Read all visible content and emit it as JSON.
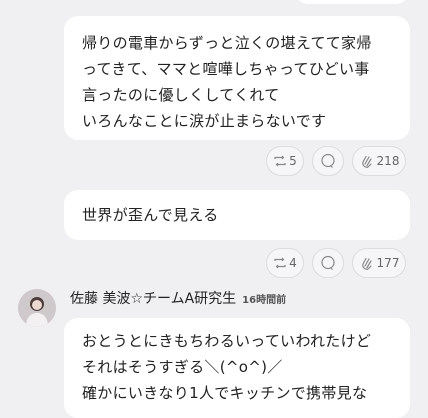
{
  "posts": [
    {
      "lines": [
        "帰りの電車からずっと泣くの堪えてて家帰",
        "ってきて、ママと喧嘩しちゃってひどい事",
        "言ったのに優しくしてくれて",
        "いろんなことに涙が止まらないです"
      ],
      "share_count": "5",
      "like_count": "218"
    },
    {
      "lines": [
        "世界が歪んで見える"
      ],
      "share_count": "4",
      "like_count": "177"
    }
  ],
  "reply": {
    "author": "佐藤 美波☆チームA研究生",
    "time": "16時間前",
    "lines": [
      "おとうとにきもちわるいっていわれたけど",
      "それはそうすぎる＼(^o^)／",
      "確かにいきなり1人でキッチンで携帯見な"
    ]
  },
  "icons": {
    "share": "retweet-icon",
    "comment": "comment-bubble-icon",
    "like": "clap-icon"
  }
}
